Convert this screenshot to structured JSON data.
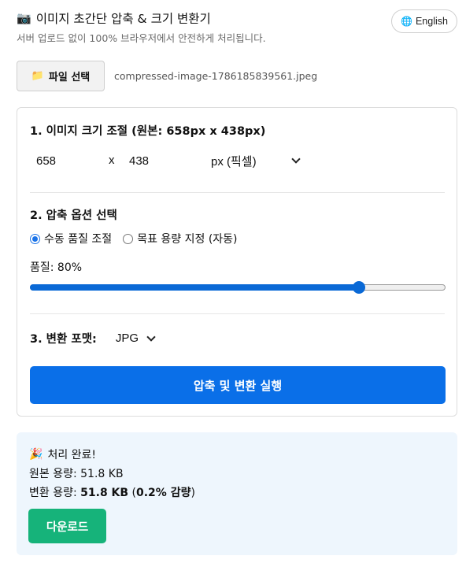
{
  "header": {
    "camera_icon": "📷",
    "title": "이미지 초간단 압축 & 크기 변환기",
    "subtitle": "서버 업로드 없이 100% 브라우저에서 안전하게 처리됩니다.",
    "lang_icon": "🌐",
    "lang_label": "English"
  },
  "file": {
    "folder_icon": "📁",
    "button_label": "파일 선택",
    "file_name": "compressed-image-1786185839561.jpeg"
  },
  "resize": {
    "title": "1. 이미지 크기 조절 (원본: 658px x 438px)",
    "width_value": "658",
    "x_label": "x",
    "height_value": "438",
    "unit_selected": "px (픽셀)"
  },
  "compression": {
    "title": "2. 압축 옵션 선택",
    "options": [
      {
        "label": "수동 품질 조절",
        "checked": true
      },
      {
        "label": "목표 용량 지정 (자동)",
        "checked": false
      }
    ],
    "quality_label": "품질: 80%",
    "quality_level": 0.8
  },
  "format": {
    "title": "3. 변환 포맷:",
    "selected": "JPG"
  },
  "run_button_label": "압축 및 변환 실행",
  "result": {
    "party_icon": "🎉",
    "title": "처리 완료!",
    "original_label": "원본 용량: ",
    "original_value": "51.8 KB",
    "converted_label": "변환 용량: ",
    "converted_value": "51.8 KB",
    "reduction_open": " (",
    "reduction_value": "0.2% 감량",
    "reduction_close": ")",
    "download_label": "다운로드"
  },
  "colors": {
    "accent": "#0a6fe8",
    "download": "#16b37a",
    "result_bg": "#eef6fd"
  }
}
